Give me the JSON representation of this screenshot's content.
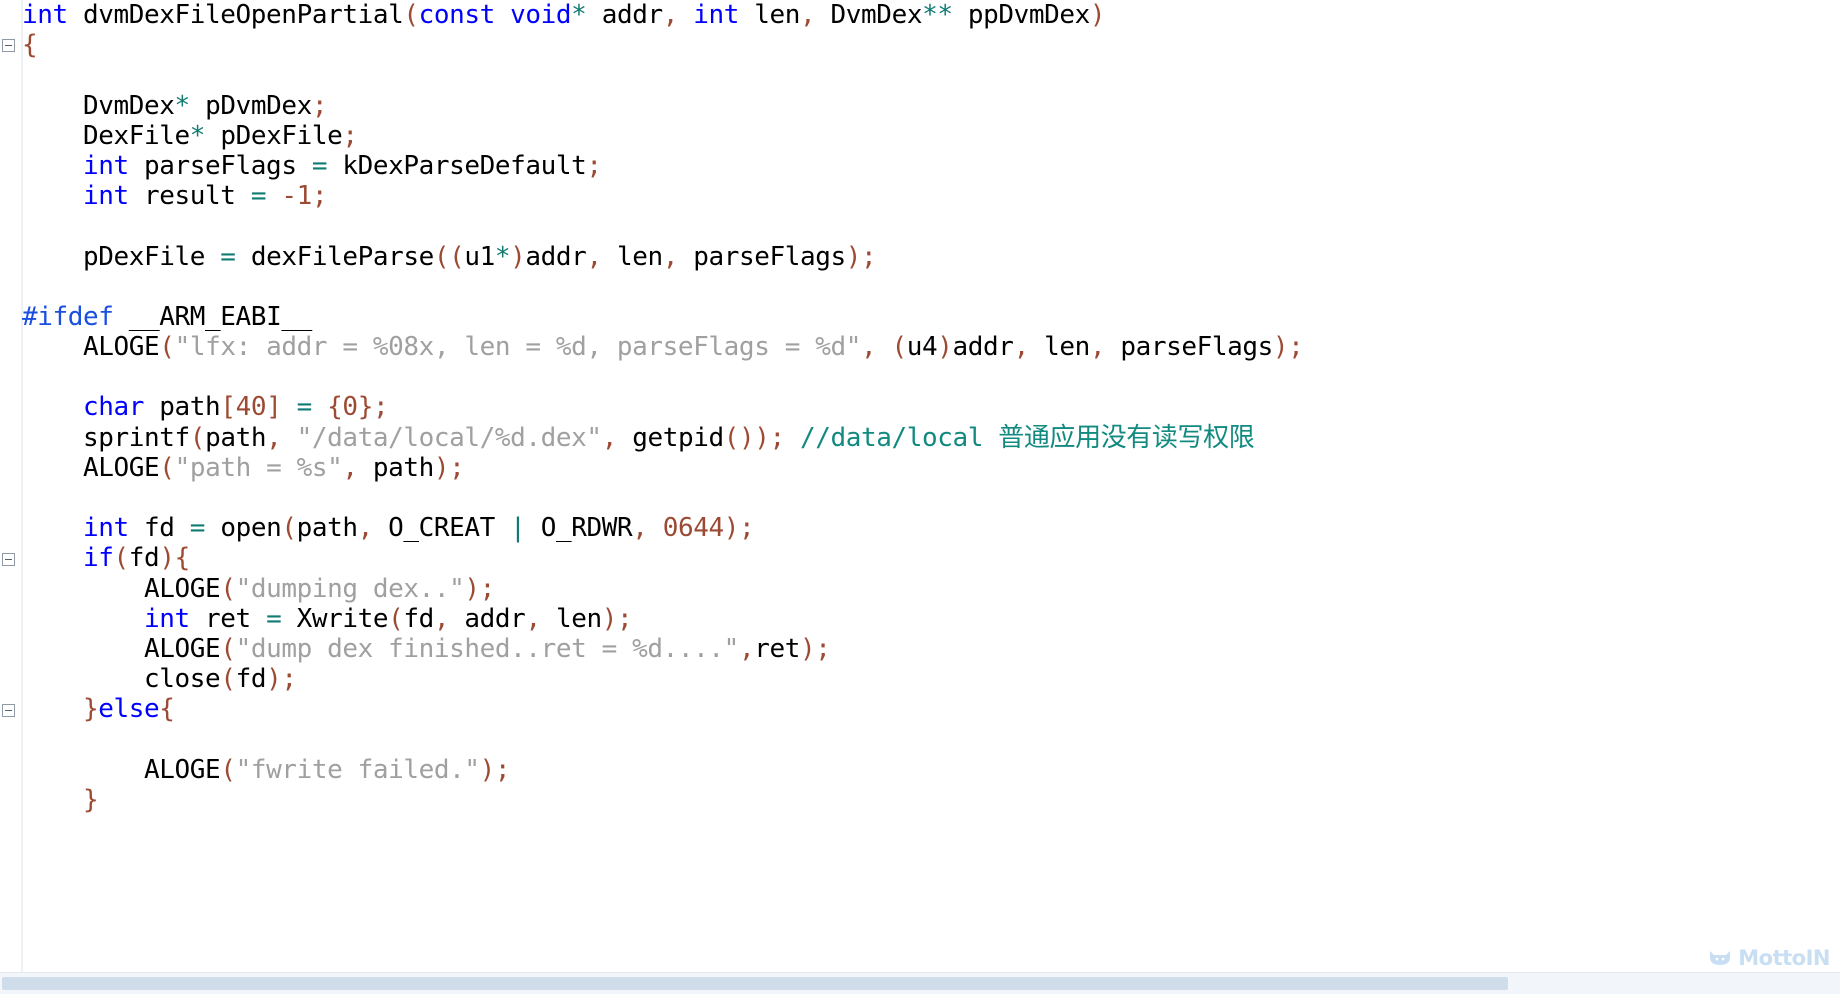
{
  "editor": {
    "language": "c",
    "colors": {
      "keyword": "#0000ff",
      "preprocessor": "#1a4fe0",
      "operator": "#0f7b72",
      "punctuation": "#9c4a33",
      "number": "#9c4a33",
      "string": "#a0a0a0",
      "comment": "#128a80",
      "plain": "#000000",
      "background": "#ffffff",
      "gutter": "#eef2f7",
      "scrollbar_track": "#f2f6fb",
      "scrollbar_thumb": "#cfdcea",
      "watermark": "#c3dcf2"
    }
  },
  "code_lines": [
    {
      "indent": 0,
      "tokens": [
        {
          "t": "int",
          "c": "kw"
        },
        {
          "t": " dvmDexFileOpenPartial",
          "c": "plain"
        },
        {
          "t": "(",
          "c": "punc"
        },
        {
          "t": "const",
          "c": "kw"
        },
        {
          "t": " ",
          "c": "plain"
        },
        {
          "t": "void",
          "c": "kw"
        },
        {
          "t": "*",
          "c": "op"
        },
        {
          "t": " addr",
          "c": "plain"
        },
        {
          "t": ",",
          "c": "punc"
        },
        {
          "t": " ",
          "c": "plain"
        },
        {
          "t": "int",
          "c": "kw"
        },
        {
          "t": " len",
          "c": "plain"
        },
        {
          "t": ",",
          "c": "punc"
        },
        {
          "t": " DvmDex",
          "c": "plain"
        },
        {
          "t": "**",
          "c": "op"
        },
        {
          "t": " ppDvmDex",
          "c": "plain"
        },
        {
          "t": ")",
          "c": "punc"
        }
      ]
    },
    {
      "indent": 0,
      "fold": true,
      "tokens": [
        {
          "t": "{",
          "c": "punc"
        }
      ]
    },
    {
      "indent": 0,
      "tokens": []
    },
    {
      "indent": 4,
      "tokens": [
        {
          "t": "DvmDex",
          "c": "plain"
        },
        {
          "t": "*",
          "c": "op"
        },
        {
          "t": " pDvmDex",
          "c": "plain"
        },
        {
          "t": ";",
          "c": "punc"
        }
      ]
    },
    {
      "indent": 4,
      "tokens": [
        {
          "t": "DexFile",
          "c": "plain"
        },
        {
          "t": "*",
          "c": "op"
        },
        {
          "t": " pDexFile",
          "c": "plain"
        },
        {
          "t": ";",
          "c": "punc"
        }
      ]
    },
    {
      "indent": 4,
      "tokens": [
        {
          "t": "int",
          "c": "kw"
        },
        {
          "t": " parseFlags ",
          "c": "plain"
        },
        {
          "t": "=",
          "c": "op"
        },
        {
          "t": " kDexParseDefault",
          "c": "plain"
        },
        {
          "t": ";",
          "c": "punc"
        }
      ]
    },
    {
      "indent": 4,
      "tokens": [
        {
          "t": "int",
          "c": "kw"
        },
        {
          "t": " result ",
          "c": "plain"
        },
        {
          "t": "=",
          "c": "op"
        },
        {
          "t": " ",
          "c": "plain"
        },
        {
          "t": "-1",
          "c": "num"
        },
        {
          "t": ";",
          "c": "punc"
        }
      ]
    },
    {
      "indent": 0,
      "tokens": []
    },
    {
      "indent": 4,
      "tokens": [
        {
          "t": "pDexFile ",
          "c": "plain"
        },
        {
          "t": "=",
          "c": "op"
        },
        {
          "t": " dexFileParse",
          "c": "plain"
        },
        {
          "t": "((",
          "c": "punc"
        },
        {
          "t": "u1",
          "c": "plain"
        },
        {
          "t": "*",
          "c": "op"
        },
        {
          "t": ")",
          "c": "punc"
        },
        {
          "t": "addr",
          "c": "plain"
        },
        {
          "t": ",",
          "c": "punc"
        },
        {
          "t": " len",
          "c": "plain"
        },
        {
          "t": ",",
          "c": "punc"
        },
        {
          "t": " parseFlags",
          "c": "plain"
        },
        {
          "t": ");",
          "c": "punc"
        }
      ]
    },
    {
      "indent": 0,
      "tokens": []
    },
    {
      "indent": 0,
      "tokens": [
        {
          "t": "#ifdef",
          "c": "pre"
        },
        {
          "t": " __ARM_EABI__",
          "c": "plain"
        }
      ]
    },
    {
      "indent": 4,
      "tokens": [
        {
          "t": "ALOGE",
          "c": "plain"
        },
        {
          "t": "(",
          "c": "punc"
        },
        {
          "t": "\"lfx: addr = %08x, len = %d, parseFlags = %d\"",
          "c": "str"
        },
        {
          "t": ",",
          "c": "punc"
        },
        {
          "t": " ",
          "c": "plain"
        },
        {
          "t": "(",
          "c": "punc"
        },
        {
          "t": "u4",
          "c": "plain"
        },
        {
          "t": ")",
          "c": "punc"
        },
        {
          "t": "addr",
          "c": "plain"
        },
        {
          "t": ",",
          "c": "punc"
        },
        {
          "t": " len",
          "c": "plain"
        },
        {
          "t": ",",
          "c": "punc"
        },
        {
          "t": " parseFlags",
          "c": "plain"
        },
        {
          "t": ");",
          "c": "punc"
        }
      ]
    },
    {
      "indent": 0,
      "tokens": []
    },
    {
      "indent": 4,
      "tokens": [
        {
          "t": "char",
          "c": "kw"
        },
        {
          "t": " path",
          "c": "plain"
        },
        {
          "t": "[",
          "c": "punc"
        },
        {
          "t": "40",
          "c": "num"
        },
        {
          "t": "]",
          "c": "punc"
        },
        {
          "t": " ",
          "c": "plain"
        },
        {
          "t": "=",
          "c": "op"
        },
        {
          "t": " ",
          "c": "plain"
        },
        {
          "t": "{",
          "c": "punc"
        },
        {
          "t": "0",
          "c": "num"
        },
        {
          "t": "};",
          "c": "punc"
        }
      ]
    },
    {
      "indent": 4,
      "tokens": [
        {
          "t": "sprintf",
          "c": "plain"
        },
        {
          "t": "(",
          "c": "punc"
        },
        {
          "t": "path",
          "c": "plain"
        },
        {
          "t": ",",
          "c": "punc"
        },
        {
          "t": " ",
          "c": "plain"
        },
        {
          "t": "\"/data/local/%d.dex\"",
          "c": "str"
        },
        {
          "t": ",",
          "c": "punc"
        },
        {
          "t": " getpid",
          "c": "plain"
        },
        {
          "t": "());",
          "c": "punc"
        },
        {
          "t": " ",
          "c": "plain"
        },
        {
          "t": "//data/local 普通应用没有读写权限",
          "c": "cmt"
        }
      ]
    },
    {
      "indent": 4,
      "tokens": [
        {
          "t": "ALOGE",
          "c": "plain"
        },
        {
          "t": "(",
          "c": "punc"
        },
        {
          "t": "\"path = %s\"",
          "c": "str"
        },
        {
          "t": ",",
          "c": "punc"
        },
        {
          "t": " path",
          "c": "plain"
        },
        {
          "t": ");",
          "c": "punc"
        }
      ]
    },
    {
      "indent": 0,
      "tokens": []
    },
    {
      "indent": 4,
      "tokens": [
        {
          "t": "int",
          "c": "kw"
        },
        {
          "t": " fd ",
          "c": "plain"
        },
        {
          "t": "=",
          "c": "op"
        },
        {
          "t": " open",
          "c": "plain"
        },
        {
          "t": "(",
          "c": "punc"
        },
        {
          "t": "path",
          "c": "plain"
        },
        {
          "t": ",",
          "c": "punc"
        },
        {
          "t": " O_CREAT ",
          "c": "plain"
        },
        {
          "t": "|",
          "c": "op"
        },
        {
          "t": " O_RDWR",
          "c": "plain"
        },
        {
          "t": ",",
          "c": "punc"
        },
        {
          "t": " ",
          "c": "plain"
        },
        {
          "t": "0644",
          "c": "num"
        },
        {
          "t": ");",
          "c": "punc"
        }
      ]
    },
    {
      "indent": 4,
      "fold": true,
      "tokens": [
        {
          "t": "if",
          "c": "kw"
        },
        {
          "t": "(",
          "c": "punc"
        },
        {
          "t": "fd",
          "c": "plain"
        },
        {
          "t": "){",
          "c": "punc"
        }
      ]
    },
    {
      "indent": 8,
      "tokens": [
        {
          "t": "ALOGE",
          "c": "plain"
        },
        {
          "t": "(",
          "c": "punc"
        },
        {
          "t": "\"dumping dex..\"",
          "c": "str"
        },
        {
          "t": ");",
          "c": "punc"
        }
      ]
    },
    {
      "indent": 8,
      "tokens": [
        {
          "t": "int",
          "c": "kw"
        },
        {
          "t": " ret ",
          "c": "plain"
        },
        {
          "t": "=",
          "c": "op"
        },
        {
          "t": " Xwrite",
          "c": "plain"
        },
        {
          "t": "(",
          "c": "punc"
        },
        {
          "t": "fd",
          "c": "plain"
        },
        {
          "t": ",",
          "c": "punc"
        },
        {
          "t": " addr",
          "c": "plain"
        },
        {
          "t": ",",
          "c": "punc"
        },
        {
          "t": " len",
          "c": "plain"
        },
        {
          "t": ");",
          "c": "punc"
        }
      ]
    },
    {
      "indent": 8,
      "tokens": [
        {
          "t": "ALOGE",
          "c": "plain"
        },
        {
          "t": "(",
          "c": "punc"
        },
        {
          "t": "\"dump dex finished..ret = %d....\"",
          "c": "str"
        },
        {
          "t": ",",
          "c": "punc"
        },
        {
          "t": "ret",
          "c": "plain"
        },
        {
          "t": ");",
          "c": "punc"
        }
      ]
    },
    {
      "indent": 8,
      "tokens": [
        {
          "t": "close",
          "c": "plain"
        },
        {
          "t": "(",
          "c": "punc"
        },
        {
          "t": "fd",
          "c": "plain"
        },
        {
          "t": ");",
          "c": "punc"
        }
      ]
    },
    {
      "indent": 4,
      "fold": true,
      "tokens": [
        {
          "t": "}",
          "c": "punc"
        },
        {
          "t": "else",
          "c": "kw"
        },
        {
          "t": "{",
          "c": "punc"
        }
      ]
    },
    {
      "indent": 0,
      "tokens": []
    },
    {
      "indent": 8,
      "tokens": [
        {
          "t": "ALOGE",
          "c": "plain"
        },
        {
          "t": "(",
          "c": "punc"
        },
        {
          "t": "\"fwrite failed.\"",
          "c": "str"
        },
        {
          "t": ");",
          "c": "punc"
        }
      ]
    },
    {
      "indent": 4,
      "tokens": [
        {
          "t": "}",
          "c": "punc"
        }
      ]
    }
  ],
  "scrollbar": {
    "orientation": "horizontal",
    "thumb_fraction": 0.82
  },
  "watermark": {
    "label": "MottoIN",
    "icon": "cat-logo-icon"
  }
}
